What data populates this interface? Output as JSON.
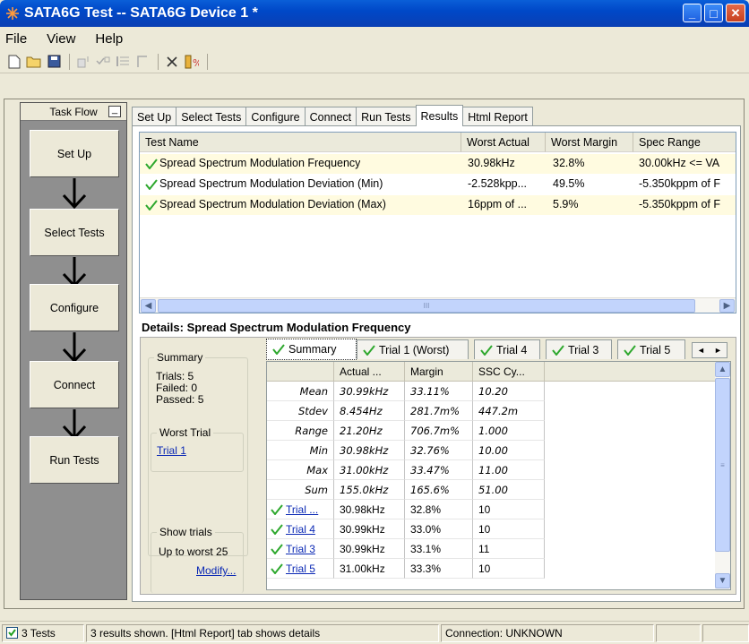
{
  "window": {
    "title": "SATA6G Test -- SATA6G Device 1 *",
    "min_label": "_",
    "max_label": "□",
    "close_label": "✕"
  },
  "menu": {
    "items": [
      "File",
      "View",
      "Help"
    ]
  },
  "taskflow": {
    "title": "Task Flow",
    "min_label": "_",
    "steps": [
      "Set Up",
      "Select Tests",
      "Configure",
      "Connect",
      "Run Tests"
    ]
  },
  "tabs": [
    "Set Up",
    "Select Tests",
    "Configure",
    "Connect",
    "Run Tests",
    "Results",
    "Html Report"
  ],
  "results_table": {
    "columns": [
      "Test Name",
      "Worst Actual",
      "Worst Margin",
      "Spec Range"
    ],
    "rows": [
      {
        "name": "Spread Spectrum Modulation Frequency",
        "actual": "30.98kHz",
        "margin": "32.8%",
        "spec": "30.00kHz <= VA"
      },
      {
        "name": "Spread Spectrum Modulation Deviation (Min)",
        "actual": "-2.528kpp...",
        "margin": "49.5%",
        "spec": "-5.350kppm of F"
      },
      {
        "name": "Spread Spectrum Modulation Deviation (Max)",
        "actual": "16ppm of ...",
        "margin": "5.9%",
        "spec": "-5.350kppm of F"
      }
    ],
    "hscroll_thumb_label": "III"
  },
  "details": {
    "title": "Details: Spread Spectrum Modulation Frequency",
    "summary_legend": "Summary",
    "trials": "Trials: 5",
    "failed": "Failed: 0",
    "passed": "Passed: 5",
    "worst_legend": "Worst Trial",
    "worst_link": "Trial 1",
    "show_legend": "Show trials",
    "show_value": "Up to worst 25",
    "modify_link": "Modify...",
    "tabs": [
      "Summary",
      "Trial 1 (Worst)",
      "Trial 4",
      "Trial 3",
      "Trial 5"
    ],
    "nav_prev": "◄",
    "nav_next": "►",
    "grid_columns": [
      "Actual ...",
      "Margin",
      "SSC Cy..."
    ],
    "stats": [
      {
        "label": "Mean",
        "actual": "30.99kHz",
        "margin": "33.11%",
        "ssc": "10.20"
      },
      {
        "label": "Stdev",
        "actual": "8.454Hz",
        "margin": "281.7m%",
        "ssc": "447.2m"
      },
      {
        "label": "Range",
        "actual": "21.20Hz",
        "margin": "706.7m%",
        "ssc": "1.000"
      },
      {
        "label": "Min",
        "actual": "30.98kHz",
        "margin": "32.76%",
        "ssc": "10.00"
      },
      {
        "label": "Max",
        "actual": "31.00kHz",
        "margin": "33.47%",
        "ssc": "11.00"
      },
      {
        "label": "Sum",
        "actual": "155.0kHz",
        "margin": "165.6%",
        "ssc": "51.00"
      }
    ],
    "trial_rows": [
      {
        "label": "Trial ...",
        "actual": "30.98kHz",
        "margin": "32.8%",
        "ssc": "10"
      },
      {
        "label": "Trial 4",
        "actual": "30.99kHz",
        "margin": "33.0%",
        "ssc": "10"
      },
      {
        "label": "Trial 3",
        "actual": "30.99kHz",
        "margin": "33.1%",
        "ssc": "11"
      },
      {
        "label": "Trial 5",
        "actual": "31.00kHz",
        "margin": "33.3%",
        "ssc": "10"
      }
    ],
    "vscroll_thumb_label": "≡"
  },
  "statusbar": {
    "tests": "3 Tests",
    "message": "3 results shown. [Html Report] tab shows details",
    "connection": "Connection: UNKNOWN"
  },
  "colors": {
    "title_blue": "#0048c8",
    "check_green": "#2ea82e",
    "highlight_row": "#fffbe0",
    "link": "#0a28b4"
  }
}
